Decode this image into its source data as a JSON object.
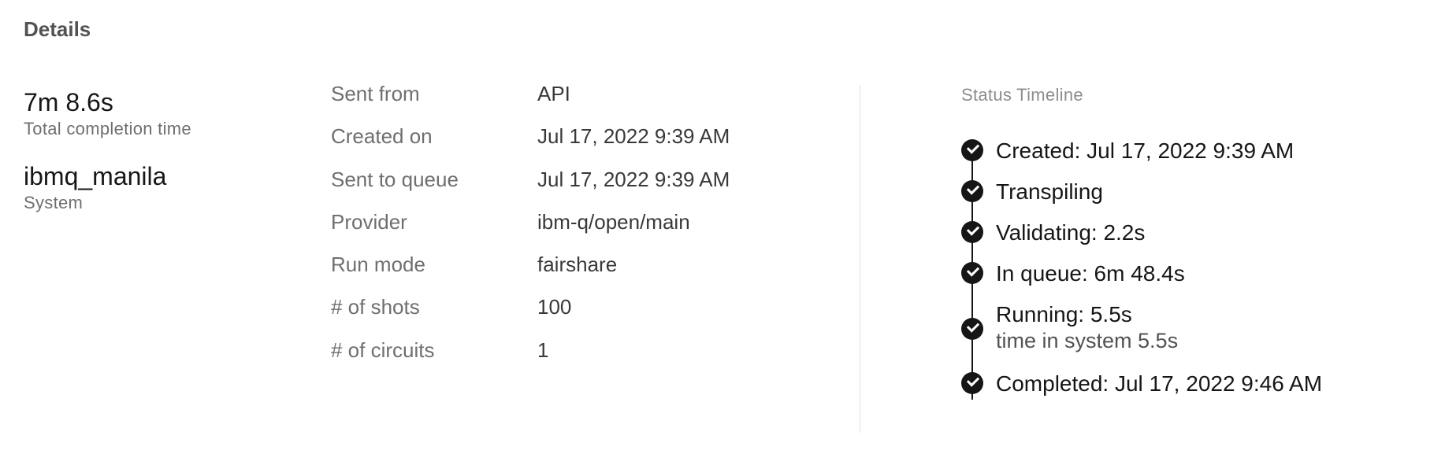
{
  "heading": "Details",
  "summary": [
    {
      "value": "7m 8.6s",
      "label": "Total completion time"
    },
    {
      "value": "ibmq_manila",
      "label": "System"
    }
  ],
  "properties": [
    {
      "key": "Sent from",
      "value": "API"
    },
    {
      "key": "Created on",
      "value": "Jul 17, 2022 9:39 AM"
    },
    {
      "key": "Sent to queue",
      "value": "Jul 17, 2022 9:39 AM"
    },
    {
      "key": "Provider",
      "value": "ibm-q/open/main"
    },
    {
      "key": "Run mode",
      "value": "fairshare"
    },
    {
      "key": "# of shots",
      "value": "100"
    },
    {
      "key": "# of circuits",
      "value": "1"
    }
  ],
  "timeline": {
    "title": "Status Timeline",
    "steps": [
      {
        "text": "Created: Jul 17, 2022 9:39 AM"
      },
      {
        "text": "Transpiling"
      },
      {
        "text": "Validating: 2.2s"
      },
      {
        "text": "In queue: 6m 48.4s"
      },
      {
        "text": "Running: 5.5s",
        "sub": "time in system 5.5s"
      },
      {
        "text": "Completed: Jul 17, 2022 9:46 AM"
      }
    ],
    "step_icon": "checkmark-filled-icon"
  }
}
